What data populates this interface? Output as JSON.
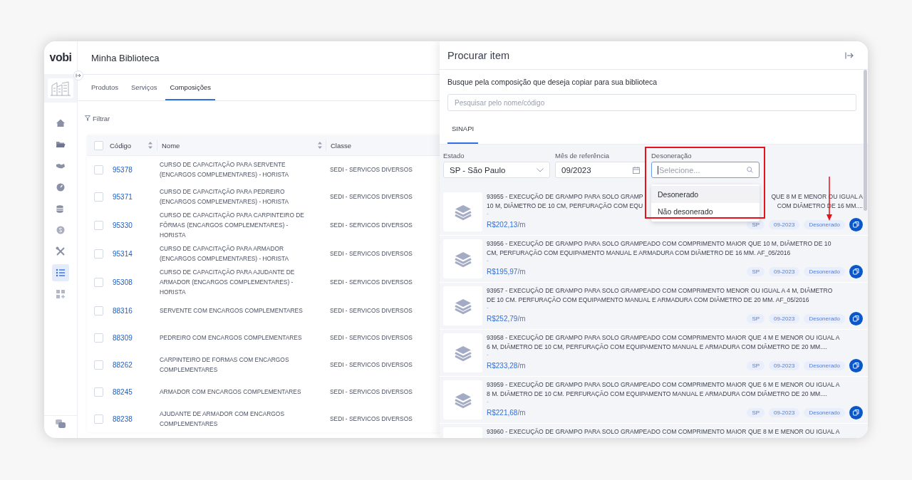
{
  "app": {
    "logo": "vobi",
    "page_title": "Minha Biblioteca"
  },
  "nav_items": [
    {
      "selected": false
    },
    {
      "selected": false
    },
    {
      "selected": false
    },
    {
      "selected": false
    },
    {
      "selected": false
    },
    {
      "selected": false
    },
    {
      "selected": false
    },
    {
      "selected": true
    },
    {
      "selected": false
    }
  ],
  "tabs": [
    {
      "label": "Produtos",
      "selected": false
    },
    {
      "label": "Serviços",
      "selected": false
    },
    {
      "label": "Composições",
      "selected": true
    }
  ],
  "filter_label": "Filtrar",
  "table": {
    "select_all_checked": false,
    "columns": [
      "Código",
      "Nome",
      "Classe"
    ],
    "rows": [
      {
        "code": "95378",
        "name_lines": [
          "CURSO DE CAPACITAÇÃO PARA SERVENTE",
          "(ENCARGOS COMPLEMENTARES) - HORISTA"
        ],
        "class": "SEDI - SERVICOS DIVERSOS",
        "checked": false
      },
      {
        "code": "95371",
        "name_lines": [
          "CURSO DE CAPACITAÇÃO PARA PEDREIRO",
          "(ENCARGOS COMPLEMENTARES) - HORISTA"
        ],
        "class": "SEDI - SERVICOS DIVERSOS",
        "checked": false
      },
      {
        "code": "95330",
        "name_lines": [
          "CURSO DE CAPACITAÇÃO PARA CARPINTEIRO DE",
          "FÔRMAS (ENCARGOS COMPLEMENTARES) -",
          "HORISTA"
        ],
        "class": "SEDI - SERVICOS DIVERSOS",
        "checked": false
      },
      {
        "code": "95314",
        "name_lines": [
          "CURSO DE CAPACITAÇÃO PARA ARMADOR",
          "(ENCARGOS COMPLEMENTARES) - HORISTA"
        ],
        "class": "SEDI - SERVICOS DIVERSOS",
        "checked": false
      },
      {
        "code": "95308",
        "name_lines": [
          "CURSO DE CAPACITAÇÃO PARA AJUDANTE DE",
          "ARMADOR (ENCARGOS COMPLEMENTARES) -",
          "HORISTA"
        ],
        "class": "SEDI - SERVICOS DIVERSOS",
        "checked": false
      },
      {
        "code": "88316",
        "name_lines": [
          "SERVENTE COM ENCARGOS COMPLEMENTARES"
        ],
        "class": "SEDI - SERVICOS DIVERSOS",
        "checked": false
      },
      {
        "code": "88309",
        "name_lines": [
          "PEDREIRO COM ENCARGOS COMPLEMENTARES"
        ],
        "class": "SEDI - SERVICOS DIVERSOS",
        "checked": false
      },
      {
        "code": "88262",
        "name_lines": [
          "CARPINTEIRO DE FORMAS COM ENCARGOS",
          "COMPLEMENTARES"
        ],
        "class": "SEDI - SERVICOS DIVERSOS",
        "checked": false
      },
      {
        "code": "88245",
        "name_lines": [
          "ARMADOR COM ENCARGOS COMPLEMENTARES"
        ],
        "class": "SEDI - SERVICOS DIVERSOS",
        "checked": false
      },
      {
        "code": "88238",
        "name_lines": [
          "AJUDANTE DE ARMADOR COM ENCARGOS",
          "COMPLEMENTARES"
        ],
        "class": "SEDI - SERVICOS DIVERSOS",
        "checked": false
      }
    ]
  },
  "panel": {
    "title": "Procurar item",
    "subtitle": "Busque pela composição que deseja copiar para sua biblioteca",
    "search": {
      "placeholder": "Pesquisar pelo nome/código"
    },
    "tabs": [
      {
        "label": "SINAPI",
        "selected": true
      }
    ],
    "filters": [
      {
        "kind": "select",
        "label": "Estado",
        "value": "SP - São Paulo"
      },
      {
        "kind": "date",
        "label": "Mês de referência",
        "value": "09/2023"
      },
      {
        "kind": "search",
        "label": "Desoneração",
        "placeholder": "Selecione..."
      }
    ],
    "dropdown": {
      "options": [
        {
          "label": "Desonerado",
          "selected": true
        },
        {
          "label": "Não desonerado",
          "selected": false
        }
      ]
    },
    "items": [
      {
        "lines": [
          [
            "93955 - EXECUÇÃO DE GRAMPO PARA SOLO GRAMP",
            "QUE 8 M E MENOR OU IGUAL A"
          ],
          [
            "10 M, DIÂMETRO DE 10 CM, PERFURAÇÃO COM EQU",
            "COM DIÂMETRO DE 16 MM...."
          ]
        ],
        "note": "-",
        "price": "R$202,13",
        "unit": "/m",
        "tags": [
          "SP",
          "09-2023",
          "Desonerado"
        ]
      },
      {
        "lines": [
          [
            "93956 - EXECUÇÃO DE GRAMPO PARA SOLO GRAMPEADO COM COMPRIMENTO MAIOR QUE 10 M, DIÂMETRO DE 10"
          ],
          [
            "CM, PERFURAÇÃO COM EQUIPAMENTO MANUAL E ARMADURA COM DIÂMETRO DE 16 MM. AF_05/2016"
          ]
        ],
        "note": "-",
        "price": "R$195,97",
        "unit": "/m",
        "tags": [
          "SP",
          "09-2023",
          "Desonerado"
        ]
      },
      {
        "lines": [
          [
            "93957 - EXECUÇÃO DE GRAMPO PARA SOLO GRAMPEADO COM COMPRIMENTO MENOR OU IGUAL A 4 M, DIÂMETRO"
          ],
          [
            "DE 10 CM. PERFURAÇÃO COM EQUIPAMENTO MANUAL E ARMADURA COM DIÂMETRO DE 20 MM. AF_05/2016"
          ]
        ],
        "note": "-",
        "price": "R$252,79",
        "unit": "/m",
        "tags": [
          "SP",
          "09-2023",
          "Desonerado"
        ]
      },
      {
        "lines": [
          [
            "93958 - EXECUÇÃO DE GRAMPO PARA SOLO GRAMPEADO COM COMPRIMENTO MAIOR QUE 4 M E MENOR OU IGUAL A"
          ],
          [
            "6 M, DIÂMETRO DE 10 CM, PERFURAÇÃO COM EQUIPAMENTO MANUAL E ARMADURA COM DIÂMETRO DE 20 MM...."
          ]
        ],
        "note": "-",
        "price": "R$233,28",
        "unit": "/m",
        "tags": [
          "SP",
          "09-2023",
          "Desonerado"
        ]
      },
      {
        "lines": [
          [
            "93959 - EXECUÇÃO DE GRAMPO PARA SOLO GRAMPEADO COM COMPRIMENTO MAIOR QUE 6 M E MENOR OU IGUAL A"
          ],
          [
            "8 M. DIÂMETRO DE 10 CM. PERFURAÇÃO COM EQUIPAMENTO MANUAL E ARMADURA COM DIÂMETRO DE 20 MM...."
          ]
        ],
        "note": "-",
        "price": "R$221,68",
        "unit": "/m",
        "tags": [
          "SP",
          "09-2023",
          "Desonerado"
        ]
      },
      {
        "lines": [
          [
            "93960 - EXECUÇÃO DE GRAMPO PARA SOLO GRAMPEADO COM COMPRIMENTO MAIOR QUE 8 M E MENOR OU IGUAL A"
          ]
        ]
      }
    ]
  }
}
